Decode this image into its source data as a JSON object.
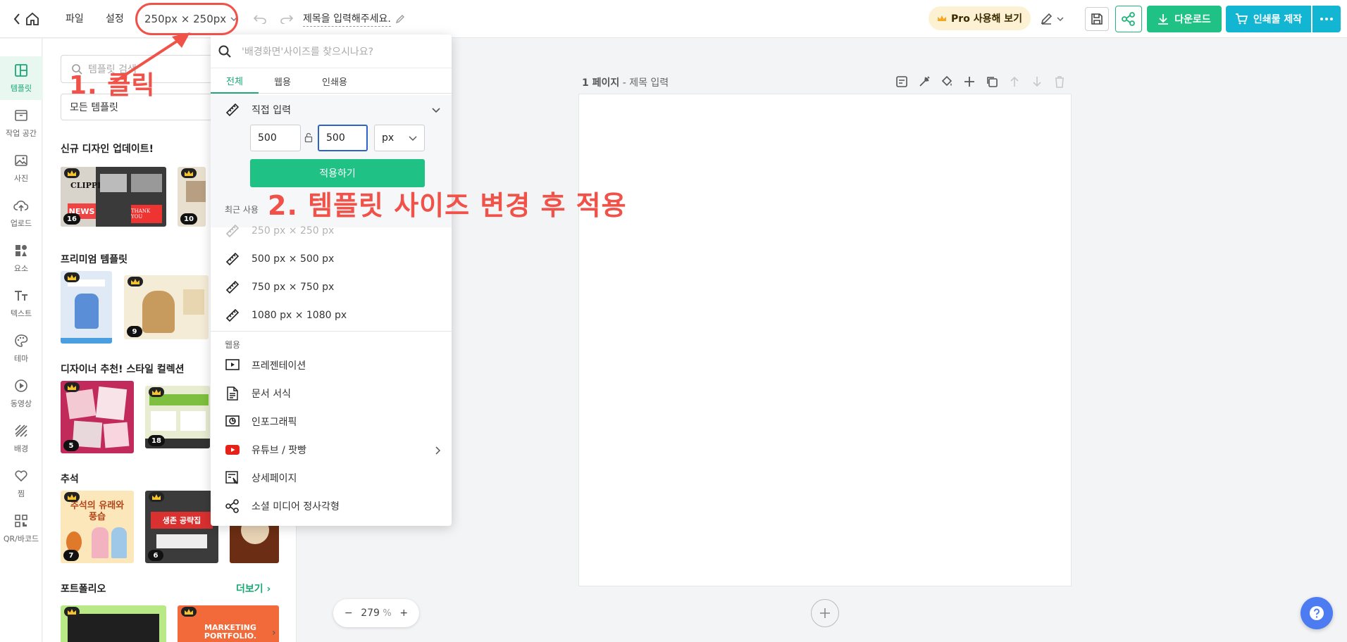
{
  "topbar": {
    "file_label": "파일",
    "settings_label": "설정",
    "size_label": "250px × 250px",
    "doc_title": "제목을 입력해주세요.",
    "pro_label": "Pro 사용해 보기",
    "download_label": "다운로드",
    "print_label": "인쇄물 제작"
  },
  "rail": {
    "items": [
      {
        "label": "템플릿",
        "icon": "layout-icon"
      },
      {
        "label": "작업 공간",
        "icon": "folder-icon"
      },
      {
        "label": "사진",
        "icon": "image-icon"
      },
      {
        "label": "업로드",
        "icon": "cloud-upload-icon"
      },
      {
        "label": "요소",
        "icon": "shapes-icon"
      },
      {
        "label": "텍스트",
        "icon": "text-icon"
      },
      {
        "label": "테마",
        "icon": "palette-icon"
      },
      {
        "label": "동영상",
        "icon": "play-icon"
      },
      {
        "label": "배경",
        "icon": "background-icon"
      },
      {
        "label": "찜",
        "icon": "heart-icon"
      },
      {
        "label": "QR/바코드",
        "icon": "qr-icon"
      }
    ]
  },
  "panel": {
    "search_placeholder": "템플릿 검색",
    "filter_label": "모든 템플릿",
    "sections": [
      {
        "title": "신규 디자인 업데이트!",
        "counts": [
          "16",
          "10"
        ]
      },
      {
        "title": "프리미엄 템플릿",
        "counts": [
          "9"
        ]
      },
      {
        "title": "디자이너 추천! 스타일 컬렉션",
        "counts": [
          "5",
          "18"
        ]
      },
      {
        "title": "추석",
        "counts": [
          "7",
          "6"
        ]
      },
      {
        "title": "포트폴리오",
        "counts": []
      }
    ],
    "more_label": "더보기",
    "thumb_texts": {
      "clippings": "CLIPPINGS",
      "news": "NEWS",
      "thankyou": "THANK YOU",
      "chuseok1": "추석의 유래와 풍습",
      "chuseok2": "생존 공략집",
      "portfolio": "MARKETING PORTFOLIO."
    }
  },
  "workspace": {
    "page_number": "1 페이지",
    "page_title": " - 제목 입력",
    "zoom_value": "279",
    "zoom_unit": "%"
  },
  "dropdown": {
    "search_placeholder": "'배경화면'사이즈를 찾으시나요?",
    "tabs": [
      "전체",
      "웹용",
      "인쇄용"
    ],
    "direct_input_label": "직접 입력",
    "width_value": "500",
    "height_value": "500",
    "unit": "px",
    "apply_label": "적용하기",
    "recent_label": "최근 사용",
    "recent": [
      "250 px × 250 px",
      "500 px × 500 px",
      "750 px × 750 px",
      "1080 px × 1080 px"
    ],
    "web_label": "웹용",
    "web_items": [
      "프레젠테이션",
      "문서 서식",
      "인포그래픽",
      "유튜브 / 팟빵",
      "상세페이지",
      "소셜 미디어 정사각형"
    ]
  },
  "annotations": {
    "step1": "1. 클릭",
    "step2": "2. 템플릿 사이즈 변경 후 적용"
  },
  "colors": {
    "accent_green": "#1fc185",
    "accent_cyan": "#12b5d2",
    "annotation_red": "#f0524a",
    "focus_blue": "#2d62c7"
  }
}
